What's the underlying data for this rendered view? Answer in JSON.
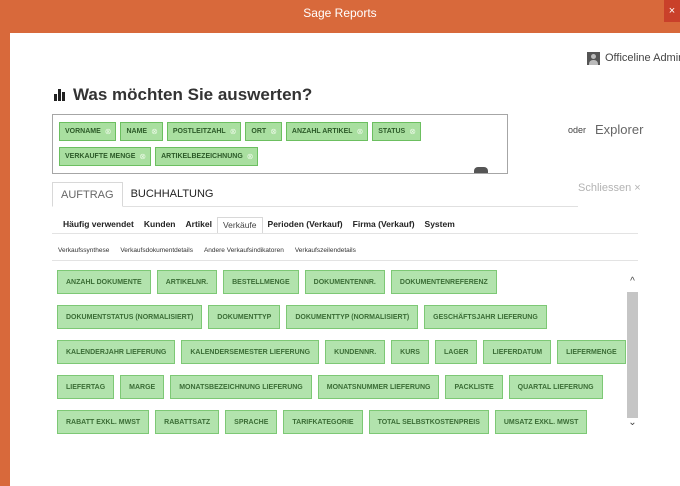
{
  "window": {
    "title": "Sage Reports",
    "close_glyph": "×"
  },
  "user": {
    "name": "Officeline Admin",
    "icon": "user-avatar-icon"
  },
  "heading": {
    "title": "Was möchten Sie auswerten?",
    "icon": "bar-chart-icon"
  },
  "selection": {
    "remove_glyph": "⊗",
    "rows": [
      [
        "VORNAME",
        "NAME",
        "POSTLEITZAHL",
        "ORT",
        "ANZAHL ARTIKEL",
        "STATUS"
      ],
      [
        "VERKAUFTE MENGE",
        "ARTIKELBEZEICHNUNG"
      ]
    ]
  },
  "explorer": {
    "prefix": "oder",
    "label": "Explorer"
  },
  "close_link": "Schliessen ×",
  "main_tabs": [
    {
      "label": "AUFTRAG",
      "active": true
    },
    {
      "label": "BUCHHALTUNG",
      "active": false
    }
  ],
  "sub_tabs": [
    {
      "label": "Häufig verwendet",
      "active": false
    },
    {
      "label": "Kunden",
      "active": false
    },
    {
      "label": "Artikel",
      "active": false
    },
    {
      "label": "Verkäufe",
      "active": true
    },
    {
      "label": "Perioden (Verkauf)",
      "active": false
    },
    {
      "label": "Firma (Verkauf)",
      "active": false
    },
    {
      "label": "System",
      "active": false
    }
  ],
  "third_tabs": [
    "Verkaufssynthese",
    "Verkaufsdokumentdetails",
    "Andere Verkaufsindikatoren",
    "Verkaufszeilendetails"
  ],
  "fields": [
    [
      "ANZAHL DOKUMENTE",
      "ARTIKELNR.",
      "BESTELLMENGE",
      "DOKUMENTENNR.",
      "DOKUMENTENREFERENZ"
    ],
    [
      "DOKUMENTSTATUS (NORMALISIERT)",
      "DOKUMENTTYP",
      "DOKUMENTTYP (NORMALISIERT)",
      "GESCHÄFTSJAHR LIEFERUNG"
    ],
    [
      "KALENDERJAHR LIEFERUNG",
      "KALENDERSEMESTER LIEFERUNG",
      "KUNDENNR.",
      "KURS",
      "LAGER",
      "LIEFERDATUM",
      "LIEFERMENGE"
    ],
    [
      "LIEFERTAG",
      "MARGE",
      "MONATSBEZEICHNUNG LIEFERUNG",
      "MONATSNUMMER LIEFERUNG",
      "PACKLISTE",
      "QUARTAL LIEFERUNG"
    ],
    [
      "RABATT EXKL. MWST",
      "RABATTSATZ",
      "SPRACHE",
      "TARIFKATEGORIE",
      "TOTAL SELBSTKOSTENPREIS",
      "UMSATZ EXKL. MWST"
    ]
  ],
  "scrollbar": {
    "up_glyph": "^",
    "down_glyph": "⌄"
  },
  "colors": {
    "accent": "#d8693b",
    "chip_fill": "#b2e3ad",
    "chip_border": "#7dc875",
    "tag_fill": "#a9dfa0"
  }
}
